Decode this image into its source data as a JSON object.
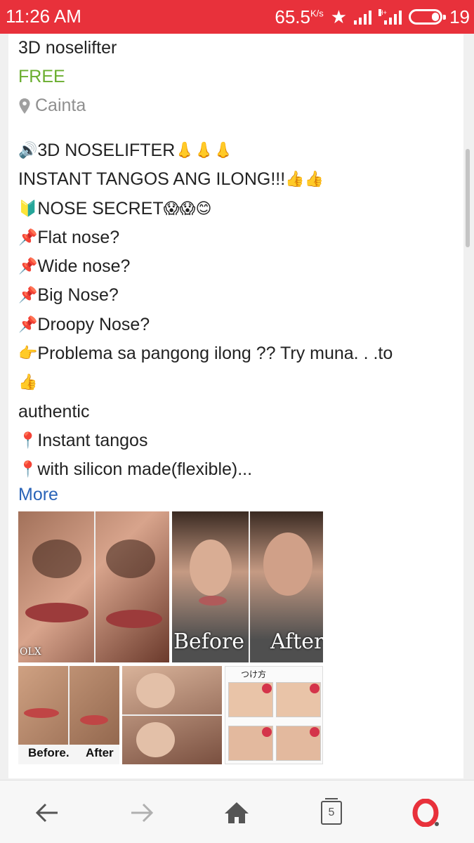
{
  "status_bar": {
    "time": "11:26 AM",
    "speed": "65.5",
    "speed_unit": "K/s",
    "battery": "19",
    "colors": {
      "background": "#e8313b"
    }
  },
  "listing": {
    "title": "3D noselifter",
    "price": "FREE",
    "location": "Cainta",
    "description_lines": [
      {
        "icon": "speaker-icon",
        "text": "3D NOSELIFTER",
        "trail": "👃👃👃"
      },
      {
        "icon": "",
        "text": "INSTANT TANGOS ANG ILONG!!!",
        "trail": "👍👍"
      },
      {
        "icon": "beginner-icon",
        "text": "NOSE SECRET ",
        "trail": "😱😱😊"
      },
      {
        "icon": "pushpin-icon",
        "text": "Flat nose?",
        "trail": ""
      },
      {
        "icon": "pushpin-icon",
        "text": "Wide nose?",
        "trail": ""
      },
      {
        "icon": "pushpin-icon",
        "text": "Big Nose?",
        "trail": ""
      },
      {
        "icon": "pushpin-icon",
        "text": "Droopy Nose?",
        "trail": ""
      },
      {
        "icon": "pointing-hand-icon",
        "text": "Problema sa pangong ilong ?? Try muna. . .to",
        "trail": ""
      },
      {
        "icon": "thumbs-up-icon",
        "text": "",
        "trail": ""
      },
      {
        "icon": "",
        "text": "authentic",
        "trail": ""
      },
      {
        "icon": "round-pin-icon",
        "text": " Instant tangos",
        "trail": ""
      },
      {
        "icon": "round-pin-icon",
        "text": " with silicon made(flexible)...",
        "trail": ""
      }
    ],
    "more_label": "More",
    "images": {
      "labels": [
        "Before",
        "After",
        "Before.",
        "After",
        "つけ方",
        "OLX"
      ]
    }
  },
  "nav": {
    "tab_count": "5",
    "icons": [
      "back-arrow-icon",
      "forward-arrow-icon",
      "home-icon",
      "tabs-icon",
      "opera-icon"
    ],
    "colors": {
      "opera": "#e8313b",
      "icon": "#555555",
      "disabled": "#b0b0b0"
    }
  }
}
